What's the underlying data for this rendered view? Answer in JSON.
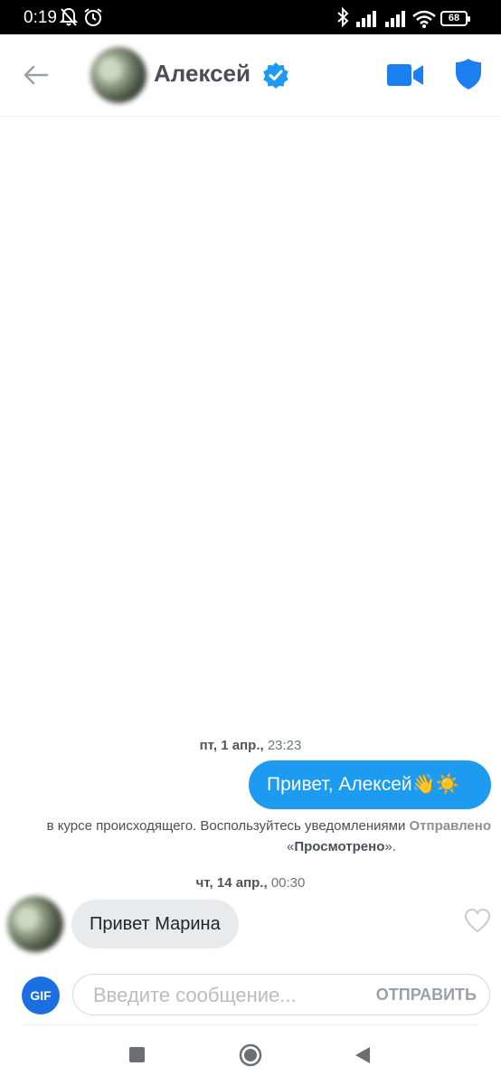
{
  "status_bar": {
    "time": "0:19",
    "battery": "68",
    "icons": [
      "bell-off-icon",
      "alarm-icon",
      "bluetooth-icon",
      "signal-icon",
      "signal-icon",
      "wifi-icon",
      "battery-icon"
    ]
  },
  "header": {
    "contact_name": "Алексей",
    "verified": true,
    "icons": [
      "back-arrow-icon",
      "verified-badge-icon",
      "video-call-icon",
      "shield-icon"
    ],
    "accent_color": "#1c9bf0"
  },
  "messages": [
    {
      "type": "date",
      "day": "пт, 1 апр.,",
      "time": "23:23"
    },
    {
      "type": "outgoing",
      "text": "Привет, Алексей👋☀️"
    },
    {
      "type": "notice",
      "line1": "в курсе происходящего. Воспользуйтесь уведомлениями",
      "line1_status": "Отправлено",
      "line2_open": "«",
      "line2_bold": "Просмотрено",
      "line2_close": "»."
    },
    {
      "type": "date",
      "day": "чт, 14 апр.,",
      "time": "00:30"
    },
    {
      "type": "incoming",
      "text": "Привет Марина"
    }
  ],
  "composer": {
    "gif_label": "GIF",
    "placeholder": "Введите сообщение...",
    "value": "",
    "send_label": "ОТПРАВИТЬ"
  },
  "nav_bar": {
    "icons": [
      "recent-apps-icon",
      "home-icon",
      "back-icon"
    ]
  }
}
